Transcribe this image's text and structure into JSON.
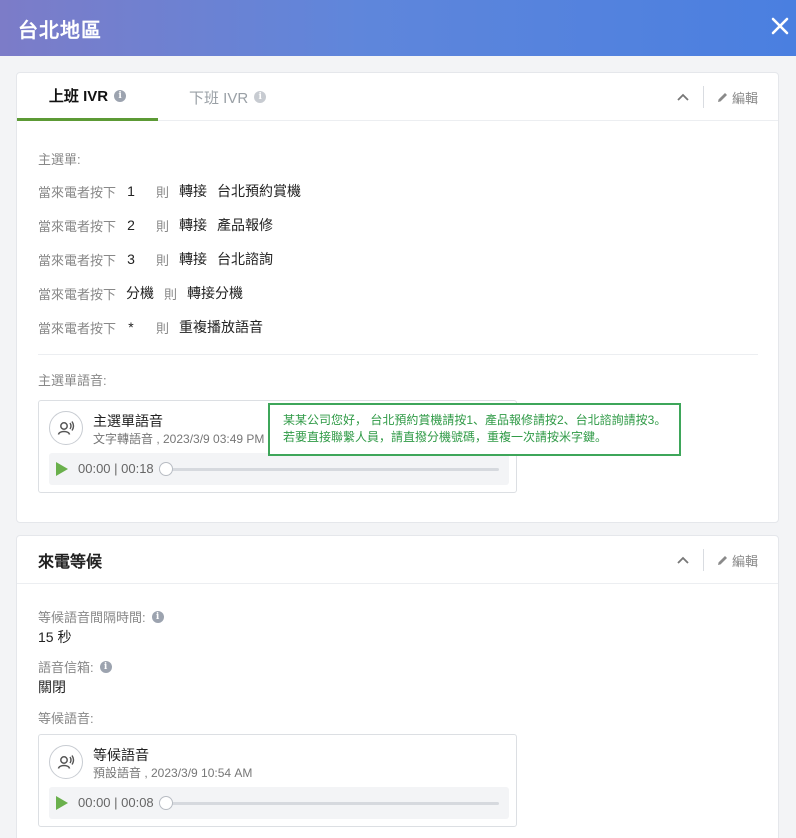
{
  "header": {
    "title": "台北地區",
    "close_icon": "close-icon"
  },
  "ivr": {
    "tabs": [
      {
        "label": "上班 IVR"
      },
      {
        "label": "下班 IVR"
      }
    ],
    "edit_label": "編輯",
    "main_menu_label": "主選單:",
    "menu": [
      {
        "prefix": "當來電者按下",
        "key": "1",
        "then": "則",
        "action": "轉接",
        "destination": "台北預約賞機"
      },
      {
        "prefix": "當來電者按下",
        "key": "2",
        "then": "則",
        "action": "轉接",
        "destination": "產品報修"
      },
      {
        "prefix": "當來電者按下",
        "key": "3",
        "then": "則",
        "action": "轉接",
        "destination": "台北諮詢"
      },
      {
        "prefix": "當來電者按下",
        "key": "分機",
        "then": "則",
        "action": "轉接分機",
        "destination": ""
      },
      {
        "prefix": "當來電者按下",
        "key": "*",
        "then": "則",
        "action": "重複播放語音",
        "destination": ""
      }
    ],
    "voice_label": "主選單語音:",
    "audio": {
      "name": "主選單語音",
      "meta": "文字轉語音 , 2023/3/9 03:49 PM",
      "time": "00:00 | 00:18",
      "progress": 0
    },
    "tooltip_lines": [
      "某某公司您好， 台北預約賞機請按1、產品報修請按2、台北諮詢請按3。",
      "若要直接聯繫人員，請直撥分機號碼，重複一次請按米字鍵。"
    ]
  },
  "waiting": {
    "title": "來電等候",
    "edit_label": "編輯",
    "interval_label": "等候語音間隔時間:",
    "interval_value": "15 秒",
    "voicemail_label": "語音信箱:",
    "voicemail_value": "關閉",
    "voice_label": "等候語音:",
    "audio": {
      "name": "等候語音",
      "meta": "預設語音 , 2023/3/9 10:54 AM",
      "time": "00:00 | 00:08",
      "progress": 0
    }
  },
  "colors": {
    "header_start": "#7c7cc8",
    "header_end": "#4a7fe0",
    "accent_green": "#5c9a35",
    "tooltip_green": "#3ea65a"
  }
}
